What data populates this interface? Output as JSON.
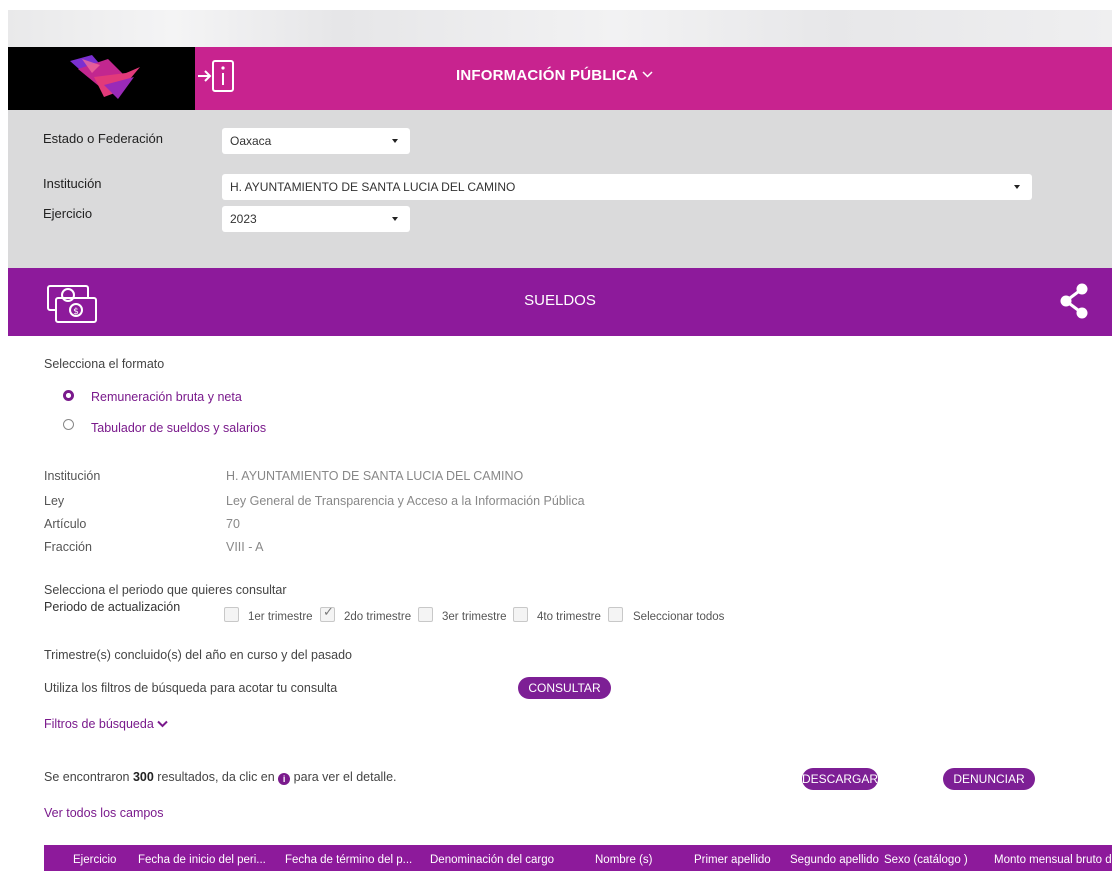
{
  "header": {
    "title": "INFORMACIÓN PÚBLICA",
    "colors": {
      "header_bg": "#c8238f",
      "section_bg": "#8d1a9b",
      "accent": "#7a1a8c",
      "panel_bg": "#dadadb"
    },
    "icons": {
      "logo": "brand-logo",
      "info": "info-exit-icon",
      "chevron": "chevron-down-icon"
    }
  },
  "filters": {
    "estado_label": "Estado o Federación",
    "estado_value": "Oaxaca",
    "institucion_label": "Institución",
    "institucion_value": "H. AYUNTAMIENTO DE SANTA LUCIA DEL CAMINO",
    "ejercicio_label": "Ejercicio",
    "ejercicio_value": "2023"
  },
  "section": {
    "title": "SUELDOS",
    "icons": {
      "money": "money-icon",
      "share": "share-icon"
    }
  },
  "format": {
    "prompt": "Selecciona el formato",
    "options": [
      {
        "label": "Remuneración bruta y neta",
        "selected": true
      },
      {
        "label": "Tabulador de sueldos y salarios",
        "selected": false
      }
    ]
  },
  "details": [
    {
      "key": "Institución",
      "value": "H. AYUNTAMIENTO DE SANTA LUCIA DEL CAMINO"
    },
    {
      "key": "Ley",
      "value": "Ley General de Transparencia y Acceso a la Información Pública"
    },
    {
      "key": "Artículo",
      "value": "70"
    },
    {
      "key": "Fracción",
      "value": "VIII - A"
    }
  ],
  "period": {
    "prompt": "Selecciona el periodo que quieres consultar",
    "label": "Periodo de actualización",
    "options": [
      {
        "label": "1er trimestre",
        "checked": false
      },
      {
        "label": "2do trimestre",
        "checked": true
      },
      {
        "label": "3er trimestre",
        "checked": false
      },
      {
        "label": "4to trimestre",
        "checked": false
      },
      {
        "label": "Seleccionar todos",
        "checked": false
      }
    ],
    "note": "Trimestre(s) concluido(s) del año en curso y del pasado"
  },
  "search": {
    "hint": "Utiliza los filtros de búsqueda para acotar tu consulta",
    "consult_button": "CONSULTAR",
    "filters_link": "Filtros de búsqueda"
  },
  "results": {
    "prefix": "Se encontraron ",
    "count": "300",
    "middle": " resultados, da clic en ",
    "suffix": " para ver el detalle.",
    "download_button": "DESCARGAR",
    "report_button": "DENUNCIAR",
    "all_fields_link": "Ver todos los campos"
  },
  "table": {
    "columns": [
      "Ejercicio",
      "Fecha de inicio del peri...",
      "Fecha de término del p...",
      "Denominación del cargo",
      "Nombre (s)",
      "Primer apellido",
      "Segundo apellido",
      "Sexo (catálogo )",
      "Monto mensual bruto d"
    ]
  }
}
